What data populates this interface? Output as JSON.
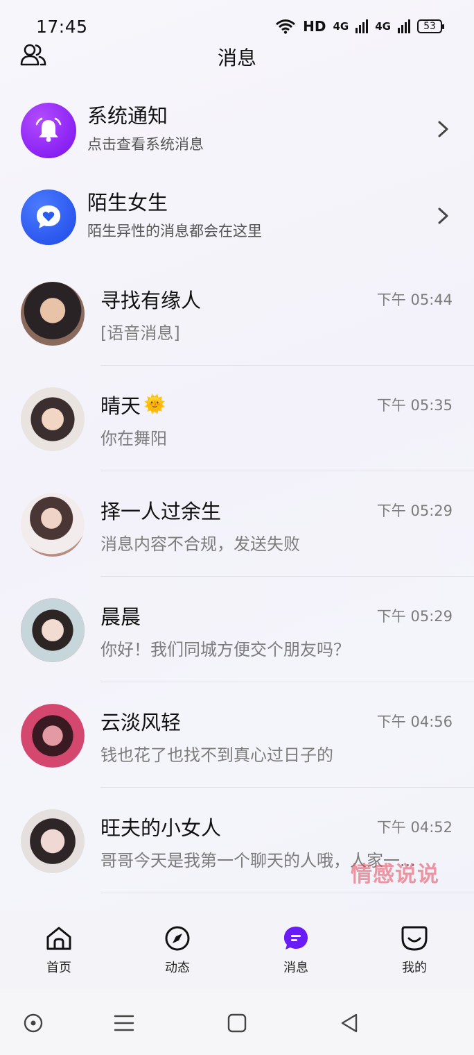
{
  "status_bar": {
    "time": "17:45",
    "network": "HD",
    "signal1": "4G",
    "signal2": "4G",
    "battery": "53"
  },
  "header": {
    "title": "消息",
    "left_icon": "contacts-icon"
  },
  "system_items": [
    {
      "title": "系统通知",
      "subtitle": "点击查看系统消息",
      "icon": "bell-icon",
      "color": "#8a2be2"
    },
    {
      "title": "陌生女生",
      "subtitle": "陌生异性的消息都会在这里",
      "icon": "heart-chat-icon",
      "color": "#2b5cf0"
    }
  ],
  "chats": [
    {
      "name": "寻找有缘人",
      "time": "下午 05:44",
      "message": "[语音消息]"
    },
    {
      "name": "晴天",
      "emoji": "🌞",
      "time": "下午 05:35",
      "message": "你在舞阳"
    },
    {
      "name": "择一人过余生",
      "time": "下午 05:29",
      "message": "消息内容不合规，发送失败"
    },
    {
      "name": "晨晨",
      "time": "下午 05:29",
      "message": "你好！我们同城方便交个朋友吗？"
    },
    {
      "name": "云淡风轻",
      "time": "下午 04:56",
      "message": "钱也花了也找不到真心过日子的"
    },
    {
      "name": "旺夫的小女人",
      "time": "下午 04:52",
      "message": "哥哥今天是我第一个聊天的人哦，人家一..."
    }
  ],
  "watermark": "情感说说",
  "tabs": [
    {
      "label": "首页",
      "icon": "home-icon"
    },
    {
      "label": "动态",
      "icon": "compass-icon"
    },
    {
      "label": "消息",
      "icon": "message-icon",
      "active": true
    },
    {
      "label": "我的",
      "icon": "profile-icon"
    }
  ],
  "colors": {
    "accent_purple": "#7a1cf0",
    "accent_blue": "#2b5cf0"
  }
}
